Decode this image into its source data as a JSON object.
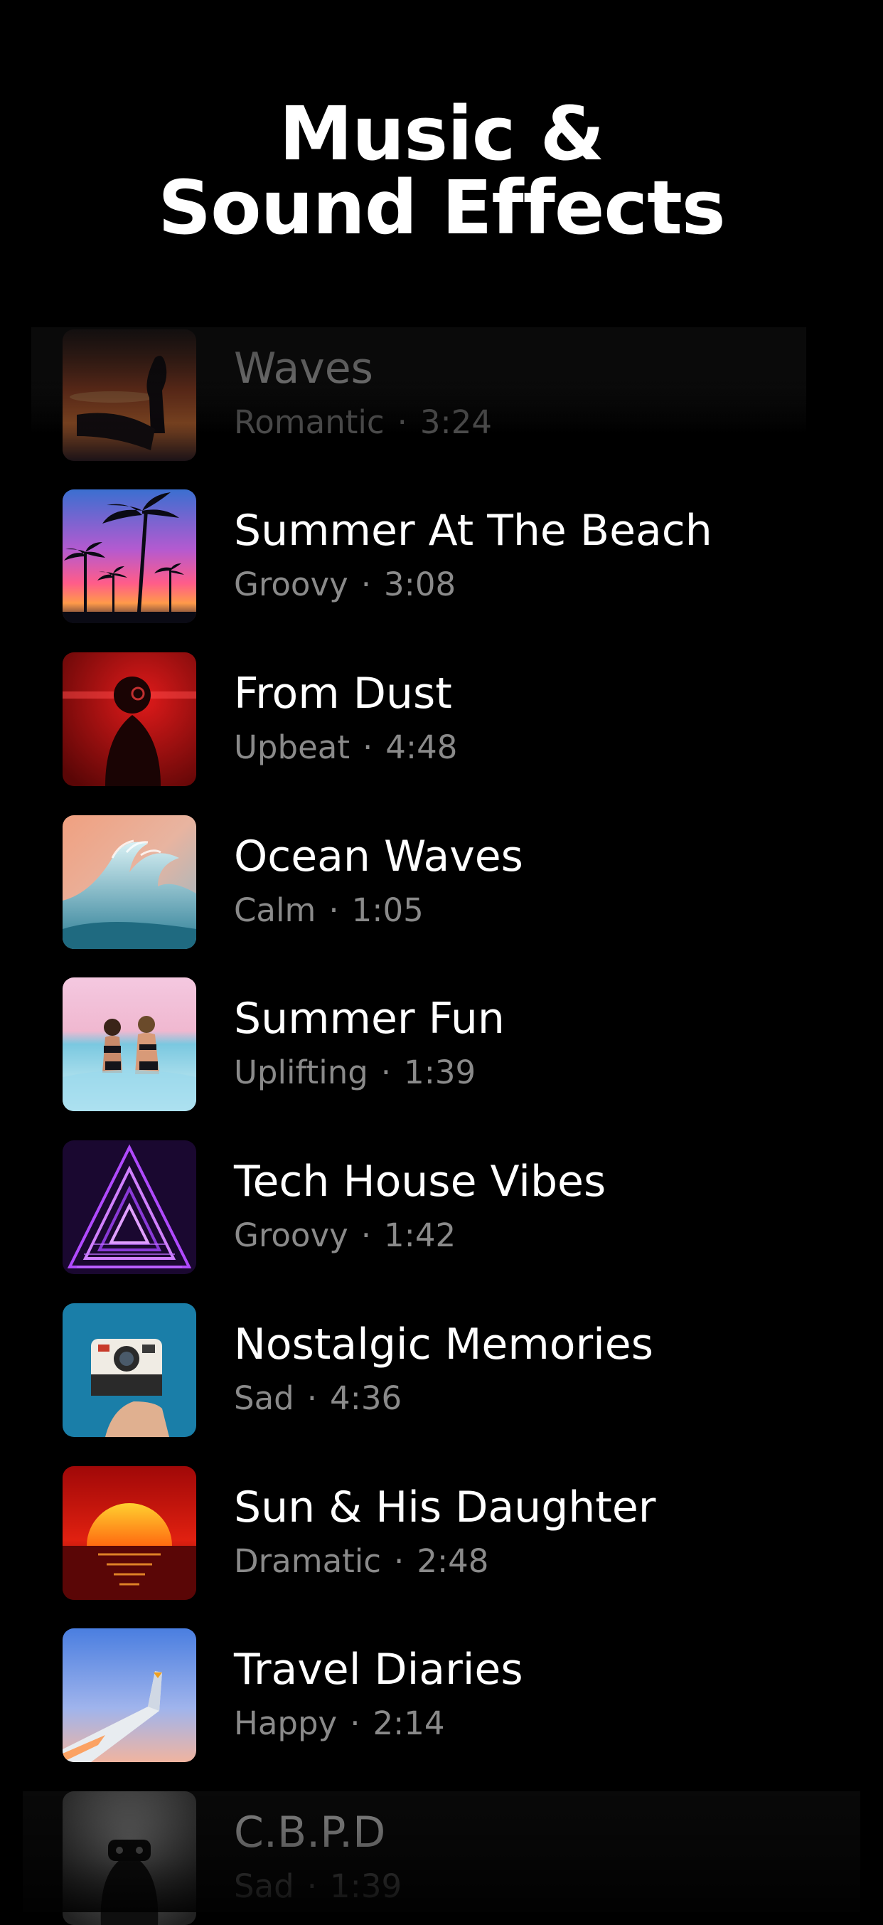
{
  "header": {
    "title_line1": "Music &",
    "title_line2": "Sound Effects"
  },
  "tracks": [
    {
      "title": "Waves",
      "mood": "Romantic",
      "duration": "3:24",
      "icon": "sunset-couple-thumbnail"
    },
    {
      "title": "Summer At The Beach",
      "mood": "Groovy",
      "duration": "3:08",
      "icon": "palm-trees-thumbnail"
    },
    {
      "title": "From Dust",
      "mood": "Upbeat",
      "duration": "4:48",
      "icon": "red-silhouette-thumbnail"
    },
    {
      "title": "Ocean Waves",
      "mood": "Calm",
      "duration": "1:05",
      "icon": "wave-thumbnail"
    },
    {
      "title": "Summer Fun",
      "mood": "Uplifting",
      "duration": "1:39",
      "icon": "beach-girls-thumbnail"
    },
    {
      "title": "Tech House Vibes",
      "mood": "Groovy",
      "duration": "1:42",
      "icon": "neon-tunnel-thumbnail"
    },
    {
      "title": "Nostalgic Memories",
      "mood": "Sad",
      "duration": "4:36",
      "icon": "polaroid-camera-thumbnail"
    },
    {
      "title": "Sun & His Daughter",
      "mood": "Dramatic",
      "duration": "2:48",
      "icon": "red-sun-thumbnail"
    },
    {
      "title": "Travel Diaries",
      "mood": "Happy",
      "duration": "2:14",
      "icon": "airplane-wing-thumbnail"
    },
    {
      "title": "C.B.P.D",
      "mood": "Sad",
      "duration": "1:39",
      "icon": "masked-face-thumbnail"
    }
  ],
  "separator": "·",
  "colors": {
    "background": "#000000",
    "title_text": "#ffffff",
    "meta_text": "#8a8a8a"
  }
}
